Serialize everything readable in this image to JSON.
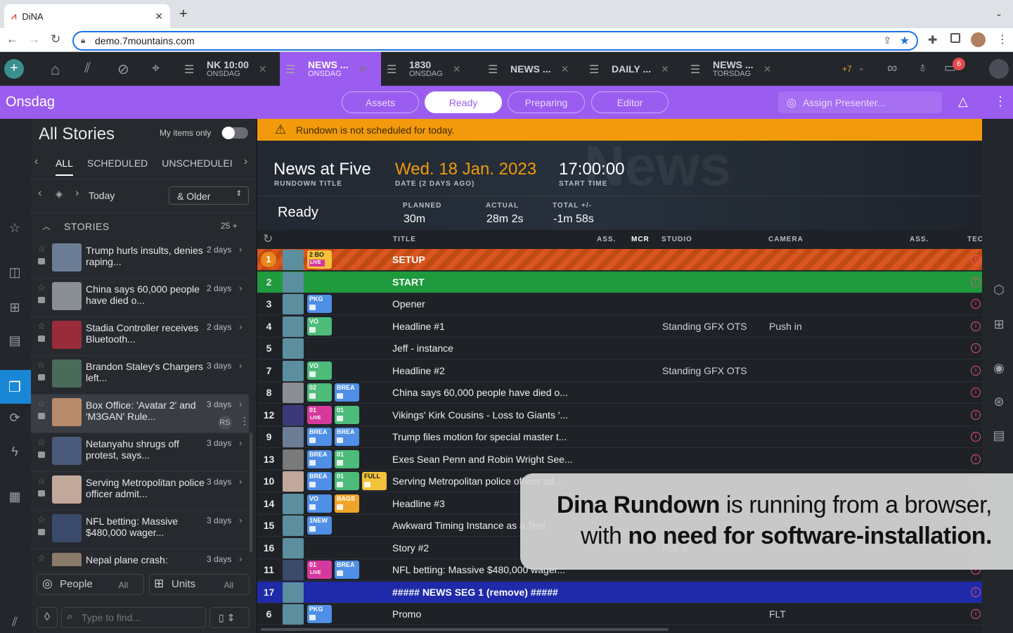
{
  "browser": {
    "tab_title": "DiNA",
    "url": "demo.7mountains.com"
  },
  "app_tabs": [
    {
      "title": "NK 10:00",
      "sub": "ONSDAG",
      "active": false
    },
    {
      "title": "NEWS ...",
      "sub": "ONSDAG",
      "active": true
    },
    {
      "title": "1830",
      "sub": "ONSDAG",
      "active": false
    },
    {
      "title": "NEWS ...",
      "sub": "",
      "active": false
    },
    {
      "title": "DAILY ...",
      "sub": "",
      "active": false
    },
    {
      "title": "NEWS ...",
      "sub": "TORSDAG",
      "active": false
    }
  ],
  "topbar": {
    "more_tabs": "+7",
    "notif_count": "6"
  },
  "purple": {
    "day": "Onsdag",
    "pills": [
      "Assets",
      "Ready",
      "Preparing",
      "Editor"
    ],
    "selected": "Ready",
    "assign": "Assign Presenter..."
  },
  "stories": {
    "title": "All Stories",
    "my_items": "My items only",
    "filters": [
      "ALL",
      "SCHEDULED",
      "UNSCHEDULEI"
    ],
    "date_label": "Today",
    "older": "& Older",
    "section": "STORIES",
    "count": "25 +",
    "items": [
      {
        "t": "Trump hurls insults, denies raping...",
        "age": "2 days",
        "c": "#6c7d96"
      },
      {
        "t": "China says 60,000 people have died o...",
        "age": "2 days",
        "c": "#8a8f95"
      },
      {
        "t": "Stadia Controller receives Bluetooth...",
        "age": "2 days",
        "c": "#9a2b3a"
      },
      {
        "t": "Brandon Staley's Chargers left...",
        "age": "3 days",
        "c": "#4a6a5a"
      },
      {
        "t": "Box Office: 'Avatar 2' and 'M3GAN' Rule...",
        "age": "3 days",
        "c": "#b98a6a",
        "badge": "RS"
      },
      {
        "t": "Netanyahu shrugs off protest, says...",
        "age": "3 days",
        "c": "#4a5a7a"
      },
      {
        "t": "Serving Metropolitan police officer admit...",
        "age": "3 days",
        "c": "#c2a89a"
      },
      {
        "t": "NFL betting: Massive $480,000 wager...",
        "age": "3 days",
        "c": "#3a4a6a"
      },
      {
        "t": "Nepal plane crash:",
        "age": "3 days",
        "c": "#8a7a6a"
      }
    ],
    "people": "People",
    "people_all": "All",
    "units": "Units",
    "units_all": "All",
    "search_placeholder": "Type to find..."
  },
  "rundown": {
    "warning": "Rundown is not scheduled for today.",
    "title": "News at Five",
    "title_lbl": "RUNDOWN TITLE",
    "date": "Wed. 18 Jan. 2023",
    "date_lbl": "DATE (2 DAYS AGO)",
    "start": "17:00:00",
    "start_lbl": "START TIME",
    "state": "Ready",
    "planned_lbl": "PLANNED",
    "planned": "30m",
    "actual_lbl": "ACTUAL",
    "actual": "28m 2s",
    "total_lbl": "TOTAL +/-",
    "total": "-1m 58s",
    "cols": {
      "title": "TITLE",
      "ass": "ASS.",
      "mcr": "MCR",
      "studio": "STUDIO",
      "camera": "CAMERA",
      "ass2": "ASS.",
      "tec": "TEC"
    },
    "rows": [
      {
        "n": "1",
        "title": "SETUP",
        "studio": "",
        "cam": "",
        "chips": [
          [
            "yellow",
            "2 BO",
            "LIVE"
          ]
        ],
        "bg": "orange"
      },
      {
        "n": "2",
        "title": "START",
        "studio": "",
        "cam": "",
        "chips": [],
        "bg": "green"
      },
      {
        "n": "3",
        "title": "Opener",
        "studio": "",
        "cam": "",
        "chips": [
          [
            "blue",
            "PKG",
            ""
          ]
        ]
      },
      {
        "n": "4",
        "title": "Headline #1",
        "studio": "Standing GFX OTS",
        "cam": "Push in",
        "chips": [
          [
            "green",
            "VO",
            ""
          ]
        ]
      },
      {
        "n": "5",
        "title": "Jeff - instance",
        "studio": "",
        "cam": "",
        "chips": []
      },
      {
        "n": "7",
        "title": "Headline #2",
        "studio": "Standing GFX OTS",
        "cam": "",
        "chips": [
          [
            "green",
            "VO",
            ""
          ]
        ]
      },
      {
        "n": "8",
        "title": "China says 60,000 people have died o...",
        "studio": "",
        "cam": "",
        "chips": [
          [
            "green",
            "02",
            ""
          ],
          [
            "blue",
            "BREA",
            ""
          ]
        ],
        "th": "#8a8f95"
      },
      {
        "n": "12",
        "title": "Vikings' Kirk Cousins - Loss to Giants '...",
        "studio": "",
        "cam": "",
        "chips": [
          [
            "pink",
            "01",
            "LIVE"
          ],
          [
            "green",
            "01",
            ""
          ]
        ],
        "th": "#3a3a7a"
      },
      {
        "n": "9",
        "title": "Trump files motion for special master t...",
        "studio": "",
        "cam": "",
        "chips": [
          [
            "blue",
            "BREA",
            ""
          ],
          [
            "blue",
            "BREA",
            ""
          ]
        ],
        "th": "#6c7d96"
      },
      {
        "n": "13",
        "title": "Exes Sean Penn and Robin Wright See...",
        "studio": "",
        "cam": "",
        "chips": [
          [
            "blue",
            "BREA",
            ""
          ],
          [
            "green",
            "01",
            ""
          ]
        ],
        "th": "#7a7a7a"
      },
      {
        "n": "10",
        "title": "Serving Metropolitan police officer ad...",
        "studio": "",
        "cam": "",
        "chips": [
          [
            "blue",
            "BREA",
            ""
          ],
          [
            "green",
            "01",
            ""
          ],
          [
            "yellow",
            "FULL",
            ""
          ]
        ],
        "th": "#c2a89a"
      },
      {
        "n": "14",
        "title": "Headline #3",
        "studio": "",
        "cam": "",
        "chips": [
          [
            "blue",
            "VO",
            ""
          ],
          [
            "orange",
            "BAGS",
            ""
          ]
        ]
      },
      {
        "n": "15",
        "title": "Awkward Timing Instance as a Test",
        "studio": "",
        "cam": "",
        "chips": [
          [
            "blue",
            "1NEW",
            ""
          ]
        ]
      },
      {
        "n": "16",
        "title": "Story #2",
        "studio": "Pos 2",
        "cam": "",
        "chips": []
      },
      {
        "n": "11",
        "title": "NFL betting: Massive $480,000 wager...",
        "studio": "",
        "cam": "",
        "chips": [
          [
            "pink",
            "01",
            "LIVE"
          ],
          [
            "blue",
            "BREA",
            ""
          ]
        ],
        "th": "#3a4a6a"
      },
      {
        "n": "17",
        "title": "##### NEWS SEG 1 (remove) #####",
        "studio": "",
        "cam": "",
        "chips": [],
        "bg": "blue"
      },
      {
        "n": "6",
        "title": "Promo",
        "studio": "",
        "cam": "FLT",
        "chips": [
          [
            "blue",
            "PKG",
            ""
          ]
        ]
      }
    ]
  },
  "overlay": {
    "line1_bold": "Dina Rundown",
    "line1_rest": " is running from a browser,",
    "line2_pre": "with ",
    "line2_bold": "no need for software-installation."
  },
  "colors": {
    "accent": "#9b5cf0",
    "warning": "#f29a0b",
    "live_green": "#1f9a3c",
    "segment_blue": "#1e2aa8"
  }
}
